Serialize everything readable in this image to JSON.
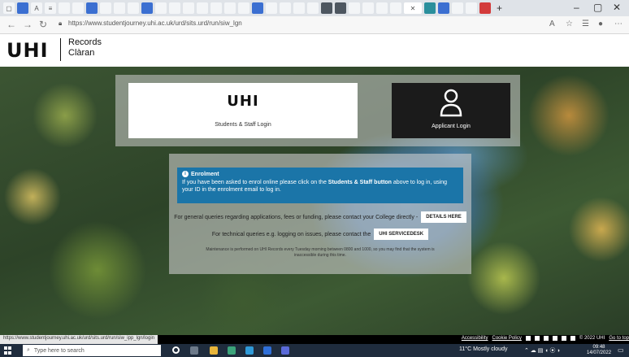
{
  "browser": {
    "url": "https://www.studentjourney.uhi.ac.uk/urd/sits.urd/run/siw_lgn",
    "tab_icons": [
      "page",
      "uhi",
      "a",
      "doc",
      "doc",
      "doc",
      "doc",
      "doc",
      "doc",
      "doc",
      "doc",
      "doc",
      "doc",
      "doc",
      "doc",
      "doc",
      "doc",
      "doc",
      "doc",
      "doc",
      "doc",
      "doc",
      "doc",
      "doc",
      "doc",
      "doc",
      "doc",
      "doc",
      "doc",
      "doc",
      "doc",
      "doc",
      "uhi"
    ],
    "new_tab": "+",
    "window_controls": {
      "minimize": "–",
      "maximize": "▢",
      "close": "✕"
    }
  },
  "site": {
    "logo": "UHI",
    "name_line1": "Records",
    "name_line2": "Clàran"
  },
  "login": {
    "staff_logo": "UHI",
    "staff_label": "Students & Staff Login",
    "applicant_label": "Applicant Login"
  },
  "info": {
    "enrolment_title": "Enrolment",
    "enrolment_text_pre": "If you have been asked to enrol online please click on the ",
    "enrolment_text_bold": "Students & Staff button",
    "enrolment_text_post": " above to log in, using your ID in the enrolment email to log in.",
    "general_text": "For general queries regarding applications, fees or funding, please contact your College directly -",
    "details_button": "DETAILS HERE",
    "tech_text": "For technical queries e.g. logging on issues, please contact the",
    "servicedesk_button": "UHI SERVICEDESK",
    "maintenance_text": "Maintenance is performed on UHI Records every Tuesday morning between 0800 and 1000, so you may find that the system is inaccessible during this time."
  },
  "footer": {
    "status_url": "https://www.studentjourney.uhi.ac.uk/urd/sits.urd/run/siw_ipp_lgn/login",
    "accessibility": "Accessibility",
    "cookie_policy": "Cookie Policy",
    "copyright": "© 2022 UHI",
    "goto_top": "Go to top"
  },
  "taskbar": {
    "search_placeholder": "Type here to search",
    "weather": "11°C  Mostly cloudy",
    "time": "09:48",
    "date": "14/07/2022"
  },
  "colors": {
    "enrol_blue": "#1b75a8",
    "applicant_dark": "#1b1b1b",
    "taskbar": "#1f2c3d"
  }
}
